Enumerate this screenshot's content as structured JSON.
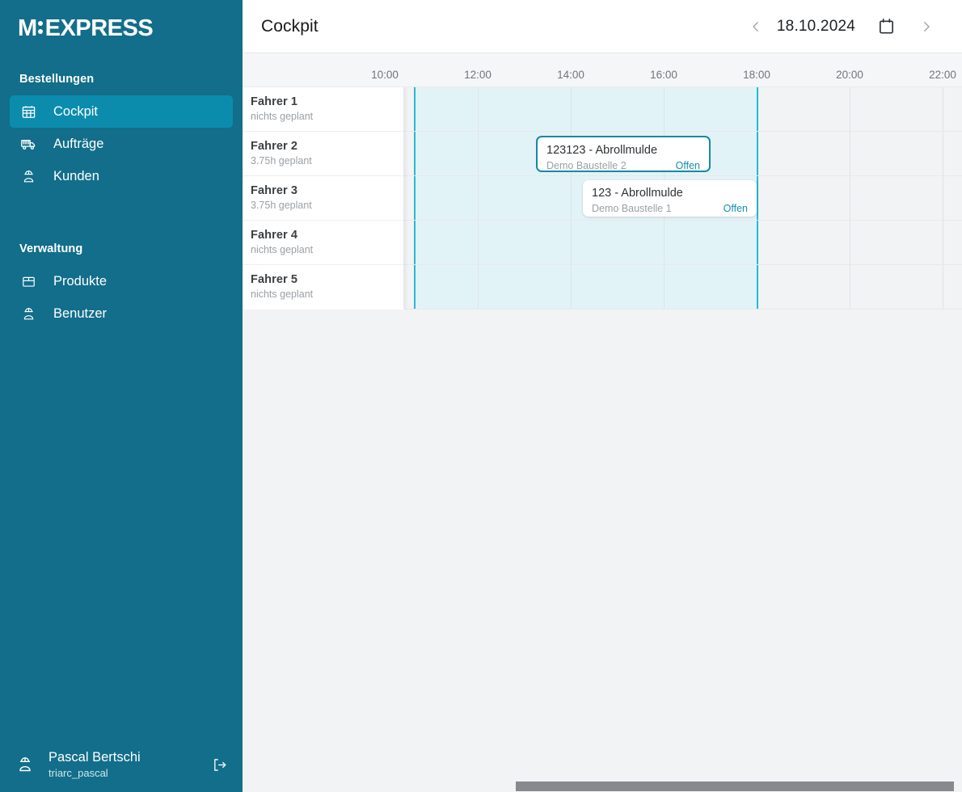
{
  "brand": {
    "logo_main": "M",
    "logo_rest": "EXPRESS",
    "accent": "#0c8cad",
    "sidebar_bg": "#126e8a"
  },
  "sidebar": {
    "sections": [
      {
        "title": "Bestellungen",
        "items": [
          {
            "label": "Cockpit",
            "icon": "calendar-grid-icon",
            "active": true
          },
          {
            "label": "Aufträge",
            "icon": "truck-icon",
            "active": false
          },
          {
            "label": "Kunden",
            "icon": "worker-person-icon",
            "active": false
          }
        ]
      },
      {
        "title": "Verwaltung",
        "items": [
          {
            "label": "Produkte",
            "icon": "box-icon",
            "active": false
          },
          {
            "label": "Benutzer",
            "icon": "worker-person-icon",
            "active": false
          }
        ]
      }
    ],
    "user": {
      "name": "Pascal Bertschi",
      "username": "triarc_pascal",
      "avatar_icon": "worker-person-icon",
      "logout_icon": "logout-icon"
    }
  },
  "topbar": {
    "title": "Cockpit",
    "prev_icon": "chevron-left-icon",
    "next_icon": "chevron-right-icon",
    "date": "18.10.2024",
    "calendar_icon": "calendar-icon"
  },
  "timeline": {
    "time_labels": [
      "10:00",
      "12:00",
      "14:00",
      "16:00",
      "18:00",
      "20:00",
      "22:00"
    ],
    "working_hours_start_label": "10:00",
    "working_hours_end_label": "18:00",
    "rows": [
      {
        "name": "Fahrer 1",
        "planned": "nichts geplant"
      },
      {
        "name": "Fahrer 2",
        "planned": "3.75h geplant"
      },
      {
        "name": "Fahrer 3",
        "planned": "3.75h geplant"
      },
      {
        "name": "Fahrer 4",
        "planned": "nichts geplant"
      },
      {
        "name": "Fahrer 5",
        "planned": "nichts geplant"
      }
    ],
    "events": [
      {
        "row": 1,
        "title": "123123 - Abrollmulde",
        "subtitle": "Demo Baustelle 2",
        "status": "Offen",
        "selected": true
      },
      {
        "row": 2,
        "title": "123 - Abrollmulde",
        "subtitle": "Demo Baustelle 1",
        "status": "Offen",
        "selected": false
      }
    ]
  }
}
